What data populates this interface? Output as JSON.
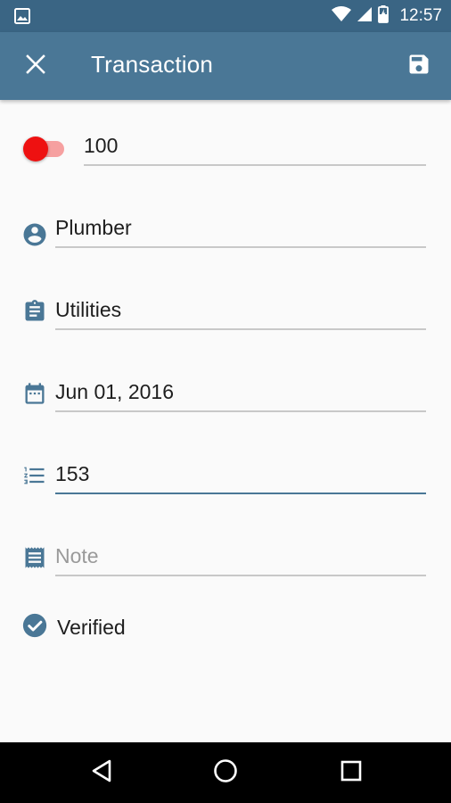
{
  "status_bar": {
    "time": "12:57",
    "icons": [
      "image-notification-icon",
      "wifi-icon",
      "signal-icon",
      "battery-charging-icon"
    ]
  },
  "app_bar": {
    "title": "Transaction",
    "close_icon": "close-icon",
    "save_icon": "save-icon"
  },
  "form": {
    "amount": {
      "value": "100",
      "type_toggle": "expense"
    },
    "payee": {
      "value": "Plumber",
      "icon": "account-circle-icon"
    },
    "category": {
      "value": "Utilities",
      "icon": "clipboard-icon"
    },
    "date": {
      "value": "Jun 01, 2016",
      "icon": "calendar-icon"
    },
    "number": {
      "value": "153",
      "icon": "numbered-list-icon"
    },
    "note": {
      "value": "",
      "placeholder": "Note",
      "icon": "receipt-icon"
    },
    "verified": {
      "label": "Verified",
      "checked": true,
      "icon": "check-circle-icon"
    }
  },
  "nav_bar": {
    "icons": [
      "back-icon",
      "home-icon",
      "recents-icon"
    ]
  },
  "colors": {
    "primary": "#4a7796",
    "primary_dark": "#3a6584",
    "accent_toggle": "#ee1111"
  }
}
